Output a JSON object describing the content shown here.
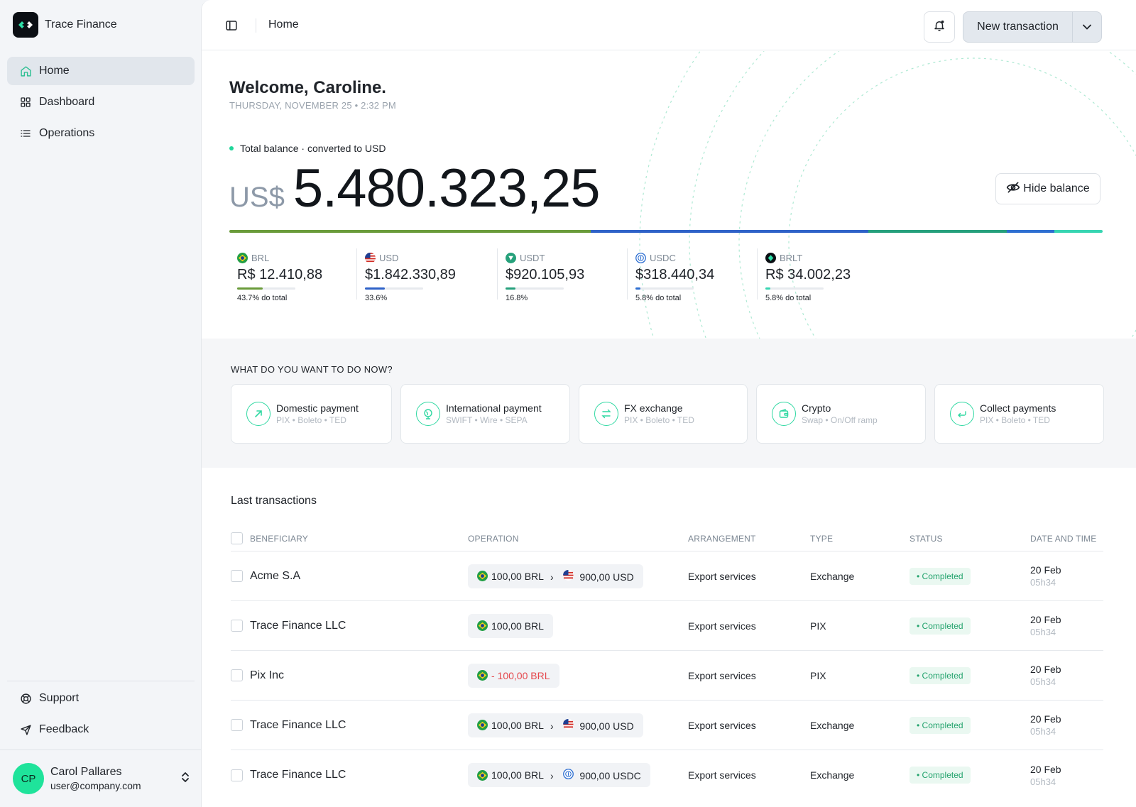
{
  "app": {
    "name": "Trace Finance"
  },
  "sidebar": {
    "items": [
      {
        "label": "Home",
        "icon": "home-icon",
        "active": true
      },
      {
        "label": "Dashboard",
        "icon": "grid-icon",
        "active": false
      },
      {
        "label": "Operations",
        "icon": "list-icon",
        "active": false
      }
    ],
    "bottom": [
      {
        "label": "Support",
        "icon": "lifebuoy-icon"
      },
      {
        "label": "Feedback",
        "icon": "send-icon"
      }
    ],
    "user": {
      "initials": "CP",
      "name": "Carol Pallares",
      "email": "user@company.com"
    }
  },
  "topbar": {
    "title": "Home",
    "new_transaction": "New transaction"
  },
  "hero": {
    "welcome": "Welcome, Caroline.",
    "date": "THURSDAY, NOVEMBER 25 • 2:32 PM",
    "balance_label": "Total balance · converted to USD",
    "currency": "US$",
    "amount": "5.480.323,25",
    "hide_balance": "Hide balance",
    "assets": [
      {
        "code": "BRL",
        "value": "R$ 12.410,88",
        "pct_label": "43.7% do total",
        "share": 0.437,
        "color": "#6a9b3a",
        "flag": "br"
      },
      {
        "code": "USD",
        "value": "$1.842.330,89",
        "pct_label": "33.6%",
        "share": 0.336,
        "color": "#2f62c8",
        "flag": "us"
      },
      {
        "code": "USDT",
        "value": "$920.105,93",
        "pct_label": "16.8%",
        "share": 0.168,
        "color": "#26a07c",
        "flag": "usdt"
      },
      {
        "code": "USDC",
        "value": "$318.440,34",
        "pct_label": "5.8% do total",
        "share": 0.058,
        "color": "#2e6fd1",
        "flag": "usdc"
      },
      {
        "code": "BRLT",
        "value": "R$ 34.002,23",
        "pct_label": "5.8% do total",
        "share": 0.058,
        "color": "#37d5b2",
        "flag": "brlt"
      }
    ]
  },
  "actions": {
    "title": "WHAT DO YOU WANT TO DO NOW?",
    "cards": [
      {
        "title": "Domestic payment",
        "sub": "PIX • Boleto • TED",
        "icon": "arrow-up-right-icon"
      },
      {
        "title": "International payment",
        "sub": "SWIFT • Wire • SEPA",
        "icon": "globe-icon"
      },
      {
        "title": "FX exchange",
        "sub": "PIX • Boleto • TED",
        "icon": "exchange-icon"
      },
      {
        "title": "Crypto",
        "sub": "Swap  • On/Off ramp",
        "icon": "wallet-icon"
      },
      {
        "title": "Collect payments",
        "sub": "PIX • Boleto • TED",
        "icon": "return-arrow-icon"
      }
    ]
  },
  "transactions": {
    "title": "Last transactions",
    "columns": {
      "beneficiary": "BENEFICIARY",
      "operation": "OPERATION",
      "arrangement": "ARRANGEMENT",
      "type": "TYPE",
      "status": "STATUS",
      "date": "DATE AND TIME"
    },
    "rows": [
      {
        "beneficiary": "Acme S.A",
        "from": "100,00 BRL",
        "from_flag": "br",
        "to": "900,00 USD",
        "to_flag": "us",
        "negative": false,
        "arrangement": "Export services",
        "type": "Exchange",
        "status": "• Completed",
        "date": "20 Feb",
        "time": "05h34"
      },
      {
        "beneficiary": "Trace Finance LLC",
        "from": "100,00 BRL",
        "from_flag": "br",
        "to": "",
        "to_flag": "",
        "negative": false,
        "arrangement": "Export services",
        "type": "PIX",
        "status": "• Completed",
        "date": "20 Feb",
        "time": "05h34"
      },
      {
        "beneficiary": "Pix Inc",
        "from": "- 100,00 BRL",
        "from_flag": "br",
        "to": "",
        "to_flag": "",
        "negative": true,
        "arrangement": "Export services",
        "type": "PIX",
        "status": "• Completed",
        "date": "20 Feb",
        "time": "05h34"
      },
      {
        "beneficiary": "Trace Finance LLC",
        "from": "100,00 BRL",
        "from_flag": "br",
        "to": "900,00 USD",
        "to_flag": "us",
        "negative": false,
        "arrangement": "Export services",
        "type": "Exchange",
        "status": "• Completed",
        "date": "20 Feb",
        "time": "05h34"
      },
      {
        "beneficiary": "Trace Finance LLC",
        "from": "100,00 BRL",
        "from_flag": "br",
        "to": "900,00 USDC",
        "to_flag": "usdc",
        "negative": false,
        "arrangement": "Export services",
        "type": "Exchange",
        "status": "• Completed",
        "date": "20 Feb",
        "time": "05h34"
      }
    ]
  }
}
